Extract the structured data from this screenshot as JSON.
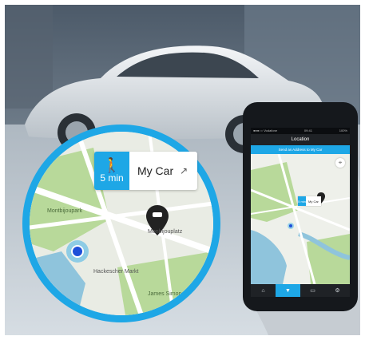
{
  "colors": {
    "accent": "#1ea7e6",
    "map_park": "#b8d99a",
    "map_water": "#8fc4dc",
    "map_road": "#ffffff",
    "pin": "#222222"
  },
  "callout": {
    "walk_icon": "walking-person-icon",
    "walk_time": "5 min",
    "destination": "My Car",
    "share_icon": "external-link-icon"
  },
  "map_labels": {
    "park1": "Montbijoupark",
    "park2": "James Simon Park",
    "street1": "Monbijouplatz",
    "street2": "Oranienburger",
    "station": "Hackescher Markt",
    "bridge": "Friedrichsbrucke",
    "rail": "S Hackescher"
  },
  "phone": {
    "status_carrier": "●●●○○ Vodafone",
    "status_time": "09:41",
    "status_battery": "100%",
    "title": "Location",
    "send_bar": "Send as Address to My Car",
    "mini_walk": "5 min",
    "mini_dest": "My Car",
    "tabs": [
      {
        "icon": "home-icon",
        "glyph": "⌂",
        "active": false
      },
      {
        "icon": "location-pin-icon",
        "glyph": "▼",
        "active": true
      },
      {
        "icon": "car-icon",
        "glyph": "▭",
        "active": false
      },
      {
        "icon": "settings-icon",
        "glyph": "⚙",
        "active": false
      }
    ]
  }
}
